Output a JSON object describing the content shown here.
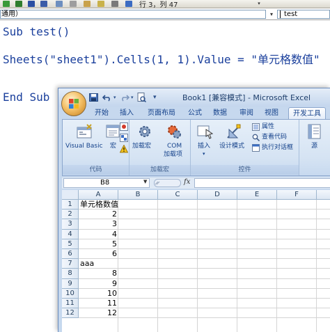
{
  "vbe": {
    "position_text": "行 3，列 47",
    "object_combo": "通用）",
    "procedure_combo": "test",
    "code_lines": [
      "Sub test()",
      "Sheets(\"sheet1\").Cells(1, 1).Value = \"单元格数值\"",
      "End Sub"
    ]
  },
  "excel": {
    "window_title": "Book1  [兼容模式] - Microsoft Excel",
    "qat_dropdown": "▾",
    "tabs": [
      {
        "label": "开始"
      },
      {
        "label": "插入"
      },
      {
        "label": "页面布局"
      },
      {
        "label": "公式"
      },
      {
        "label": "数据"
      },
      {
        "label": "审阅"
      },
      {
        "label": "视图"
      },
      {
        "label": "开发工具",
        "active": true
      }
    ],
    "ribbon": {
      "code_group": {
        "label": "代码",
        "visual_basic": "Visual Basic",
        "macro": "宏"
      },
      "addins_group": {
        "label": "加载宏",
        "addins": "加载宏",
        "com_line1": "COM",
        "com_line2": "加载项"
      },
      "controls_group": {
        "label": "控件",
        "insert": "插入",
        "design_mode": "设计模式",
        "properties": "属性",
        "view_code": "查看代码",
        "run_dialog": "执行对话框"
      },
      "source_label": "源"
    },
    "name_box": "B8",
    "fx_label": "fx",
    "columns": [
      "A",
      "B",
      "C",
      "D",
      "E",
      "F"
    ],
    "rows": [
      "1",
      "2",
      "3",
      "4",
      "5",
      "6",
      "7",
      "8",
      "9",
      "10",
      "11",
      "12"
    ],
    "cells": [
      {
        "text": "单元格数值",
        "numeric": false
      },
      {
        "text": "2",
        "numeric": true
      },
      {
        "text": "3",
        "numeric": true
      },
      {
        "text": "4",
        "numeric": true
      },
      {
        "text": "5",
        "numeric": true
      },
      {
        "text": "6",
        "numeric": true
      },
      {
        "text": "aaa",
        "numeric": false
      },
      {
        "text": "8",
        "numeric": true
      },
      {
        "text": "9",
        "numeric": true
      },
      {
        "text": "10",
        "numeric": true
      },
      {
        "text": "11",
        "numeric": true
      },
      {
        "text": "12",
        "numeric": true
      }
    ]
  },
  "colors": {
    "code_text": "#1a3f9c",
    "ribbon_text": "#15428b",
    "ribbon_bg": "#d5e3f3"
  }
}
